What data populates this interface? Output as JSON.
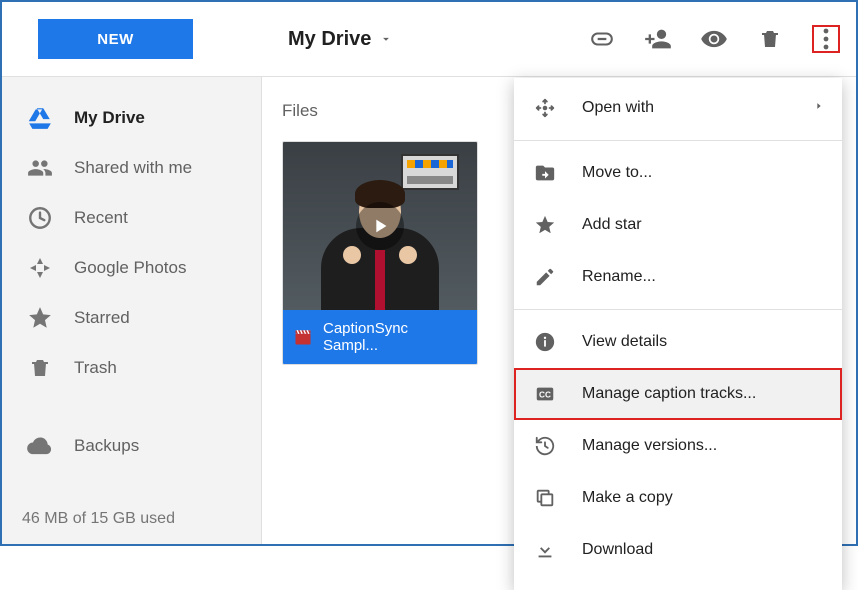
{
  "header": {
    "new_btn": "NEW",
    "breadcrumb": "My Drive"
  },
  "sidebar": {
    "items": [
      {
        "label": "My Drive"
      },
      {
        "label": "Shared with me"
      },
      {
        "label": "Recent"
      },
      {
        "label": "Google Photos"
      },
      {
        "label": "Starred"
      },
      {
        "label": "Trash"
      },
      {
        "label": "Backups"
      }
    ],
    "storage": "46 MB of 15 GB used"
  },
  "main": {
    "section_label": "Files",
    "file_name": "CaptionSync Sampl..."
  },
  "menu": {
    "open_with": "Open with",
    "move_to": "Move to...",
    "add_star": "Add star",
    "rename": "Rename...",
    "view_details": "View details",
    "manage_captions": "Manage caption tracks...",
    "manage_versions": "Manage versions...",
    "make_copy": "Make a copy",
    "download": "Download"
  }
}
